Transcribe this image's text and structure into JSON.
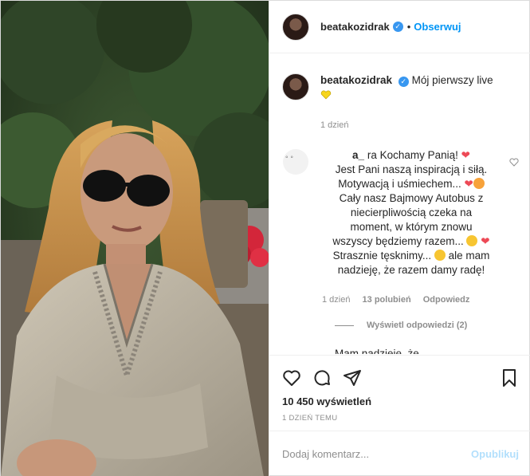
{
  "header": {
    "username": "beatakozidrak",
    "dot": "•",
    "follow_label": "Obserwuj"
  },
  "caption": {
    "username": "beatakozidrak",
    "text": "Mój pierwszy live",
    "time": "1 dzień"
  },
  "comment": {
    "username_visible": "a_",
    "text_parts": [
      "ra Kochamy Panią!",
      "Jest Pani naszą inspiracją i siłą.",
      "Motywacją i uśmiechem...",
      "Cały nasz Bajmowy Autobus z",
      "niecierpliwością czeka na",
      "moment, w którym znowu",
      "wszyscy będziemy razem...",
      "Strasznie tęsknimy...",
      "ale mam",
      "nadzieję, że razem damy radę!"
    ],
    "time": "1 dzień",
    "likes": "13 polubień",
    "reply_label": "Odpowiedz",
    "view_replies": "Wyświetl odpowiedzi (2)"
  },
  "next_comment_partial": "Mam nadzieję, że",
  "stats": {
    "views": "10 450 wyświetleń",
    "date": "1 DZIEŃ TEMU"
  },
  "add_comment": {
    "placeholder": "Dodaj komentarz...",
    "publish_label": "Opublikuj"
  },
  "icons": [
    "heart-icon",
    "comment-icon",
    "share-icon",
    "bookmark-icon",
    "verified-icon"
  ],
  "colors": {
    "link": "#0095f6",
    "publish_disabled": "#b2dffc",
    "muted": "#8e8e8e",
    "heart": "#ed4956",
    "verified": "#3897f0"
  }
}
